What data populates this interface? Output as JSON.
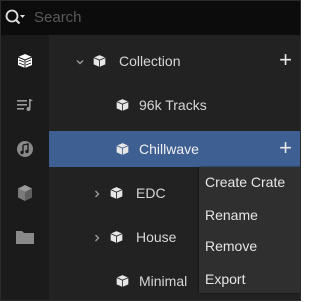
{
  "search": {
    "placeholder": "Search"
  },
  "sidebar": {
    "buttons": [
      {
        "icon": "crate-icon",
        "active": true
      },
      {
        "icon": "playlist-icon",
        "active": false
      },
      {
        "icon": "music-disc-icon",
        "active": false
      },
      {
        "icon": "box-icon",
        "active": false
      },
      {
        "icon": "folder-icon",
        "active": false
      }
    ]
  },
  "tree": {
    "items": [
      {
        "label": "Collection",
        "expanded": true,
        "has_children": true,
        "add_label": "+"
      },
      {
        "label": "96k Tracks"
      },
      {
        "label": "Chillwave",
        "selected": true,
        "add_label": "+"
      },
      {
        "label": "EDC",
        "has_children": true
      },
      {
        "label": "House",
        "has_children": true
      },
      {
        "label": "Minimal"
      }
    ]
  },
  "context_menu": {
    "items": [
      "Create Crate",
      "Rename",
      "Remove",
      "Export"
    ]
  },
  "colors": {
    "selected_row": "#3e5f92",
    "panel_bg": "#222222",
    "sidebar_bg": "#1b1b1b",
    "menu_bg": "#2f2f2f"
  }
}
